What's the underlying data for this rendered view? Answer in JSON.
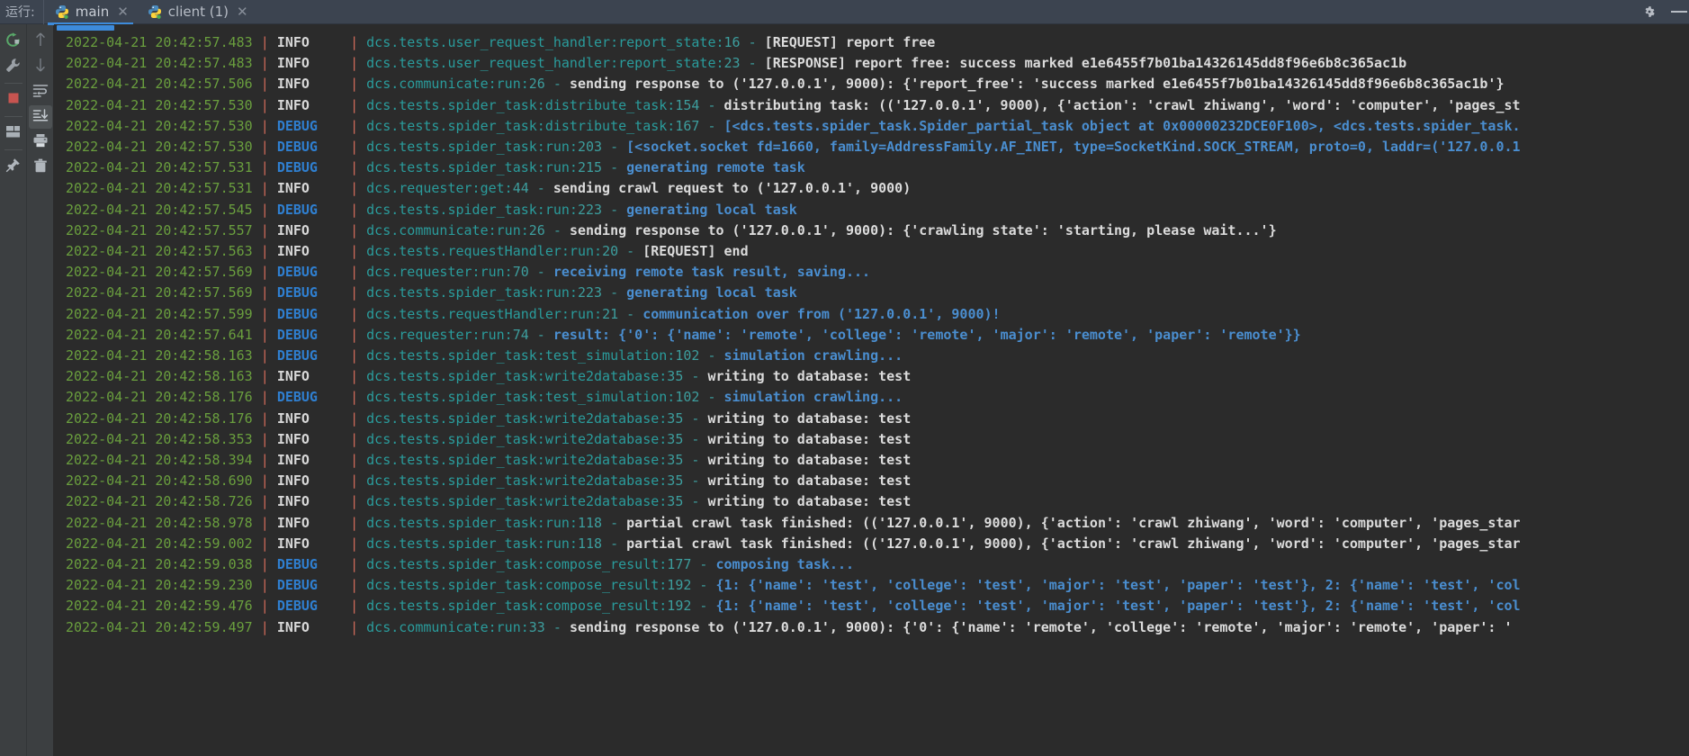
{
  "header": {
    "run_label": "运行:",
    "tabs": [
      {
        "label": "main",
        "close": "✕",
        "active": true,
        "icon": "python-icon"
      },
      {
        "label": "client (1)",
        "close": "✕",
        "active": false,
        "icon": "python-icon"
      }
    ],
    "actions": [
      {
        "name": "settings-gear-icon",
        "label": ""
      },
      {
        "name": "minimize-icon",
        "label": ""
      }
    ]
  },
  "toolbar_left": [
    {
      "name": "rerun-button",
      "icon": "rerun-icon"
    },
    {
      "name": "edit-configuration-button",
      "icon": "wrench-icon"
    },
    {
      "name": "stop-button",
      "icon": "stop-icon"
    },
    {
      "name": "layout-button",
      "icon": "layout-icon"
    },
    {
      "name": "pin-tab-button",
      "icon": "pin-icon"
    }
  ],
  "toolbar_right": [
    {
      "name": "up-the-stack-trace-button",
      "icon": "arrow-up-icon"
    },
    {
      "name": "down-the-stack-trace-button",
      "icon": "arrow-down-icon"
    },
    {
      "name": "soft-wrap-button",
      "icon": "soft-wrap-icon"
    },
    {
      "name": "scroll-to-end-button",
      "icon": "scroll-to-end-icon",
      "selected": true
    },
    {
      "name": "print-button",
      "icon": "print-icon"
    },
    {
      "name": "clear-all-button",
      "icon": "trash-icon"
    }
  ],
  "console": {
    "separator": "|",
    "dash": "-",
    "lines": [
      {
        "ts": "2022-04-21 20:42:57.483",
        "level": "INFO",
        "src": "dcs.tests.user_request_handler:report_state",
        "lno": "16",
        "msg": "[REQUEST] report free"
      },
      {
        "ts": "2022-04-21 20:42:57.483",
        "level": "INFO",
        "src": "dcs.tests.user_request_handler:report_state",
        "lno": "23",
        "msg": "[RESPONSE] report free: success marked e1e6455f7b01ba14326145dd8f96e6b8c365ac1b"
      },
      {
        "ts": "2022-04-21 20:42:57.506",
        "level": "INFO",
        "src": "dcs.communicate:run",
        "lno": "26",
        "msg": "sending response to ('127.0.0.1', 9000): {'report_free': 'success marked e1e6455f7b01ba14326145dd8f96e6b8c365ac1b'}"
      },
      {
        "ts": "2022-04-21 20:42:57.530",
        "level": "INFO",
        "src": "dcs.tests.spider_task:distribute_task",
        "lno": "154",
        "msg": "distributing task: (('127.0.0.1', 9000), {'action': 'crawl zhiwang', 'word': 'computer', 'pages_st"
      },
      {
        "ts": "2022-04-21 20:42:57.530",
        "level": "DEBUG",
        "src": "dcs.tests.spider_task:distribute_task",
        "lno": "167",
        "msg": "[<dcs.tests.spider_task.Spider_partial_task object at 0x00000232DCE0F100>, <dcs.tests.spider_task."
      },
      {
        "ts": "2022-04-21 20:42:57.530",
        "level": "DEBUG",
        "src": "dcs.tests.spider_task:run",
        "lno": "203",
        "msg": "[<socket.socket fd=1660, family=AddressFamily.AF_INET, type=SocketKind.SOCK_STREAM, proto=0, laddr=('127.0.0.1"
      },
      {
        "ts": "2022-04-21 20:42:57.531",
        "level": "DEBUG",
        "src": "dcs.tests.spider_task:run",
        "lno": "215",
        "msg": "generating remote task"
      },
      {
        "ts": "2022-04-21 20:42:57.531",
        "level": "INFO",
        "src": "dcs.requester:get",
        "lno": "44",
        "msg": "sending crawl request to ('127.0.0.1', 9000)"
      },
      {
        "ts": "2022-04-21 20:42:57.545",
        "level": "DEBUG",
        "src": "dcs.tests.spider_task:run",
        "lno": "223",
        "msg": "generating local task"
      },
      {
        "ts": "2022-04-21 20:42:57.557",
        "level": "INFO",
        "src": "dcs.communicate:run",
        "lno": "26",
        "msg": "sending response to ('127.0.0.1', 9000): {'crawling state': 'starting, please wait...'}"
      },
      {
        "ts": "2022-04-21 20:42:57.563",
        "level": "INFO",
        "src": "dcs.tests.requestHandler:run",
        "lno": "20",
        "msg": "[REQUEST] end"
      },
      {
        "ts": "2022-04-21 20:42:57.569",
        "level": "DEBUG",
        "src": "dcs.requester:run",
        "lno": "70",
        "msg": "receiving remote task result, saving..."
      },
      {
        "ts": "2022-04-21 20:42:57.569",
        "level": "DEBUG",
        "src": "dcs.tests.spider_task:run",
        "lno": "223",
        "msg": "generating local task"
      },
      {
        "ts": "2022-04-21 20:42:57.599",
        "level": "DEBUG",
        "src": "dcs.tests.requestHandler:run",
        "lno": "21",
        "msg": "communication over from ('127.0.0.1', 9000)!"
      },
      {
        "ts": "2022-04-21 20:42:57.641",
        "level": "DEBUG",
        "src": "dcs.requester:run",
        "lno": "74",
        "msg": "result: {'0': {'name': 'remote', 'college': 'remote', 'major': 'remote', 'paper': 'remote'}}"
      },
      {
        "ts": "2022-04-21 20:42:58.163",
        "level": "DEBUG",
        "src": "dcs.tests.spider_task:test_simulation",
        "lno": "102",
        "msg": "simulation crawling..."
      },
      {
        "ts": "2022-04-21 20:42:58.163",
        "level": "INFO",
        "src": "dcs.tests.spider_task:write2database",
        "lno": "35",
        "msg": "writing to database: test"
      },
      {
        "ts": "2022-04-21 20:42:58.176",
        "level": "DEBUG",
        "src": "dcs.tests.spider_task:test_simulation",
        "lno": "102",
        "msg": "simulation crawling..."
      },
      {
        "ts": "2022-04-21 20:42:58.176",
        "level": "INFO",
        "src": "dcs.tests.spider_task:write2database",
        "lno": "35",
        "msg": "writing to database: test"
      },
      {
        "ts": "2022-04-21 20:42:58.353",
        "level": "INFO",
        "src": "dcs.tests.spider_task:write2database",
        "lno": "35",
        "msg": "writing to database: test"
      },
      {
        "ts": "2022-04-21 20:42:58.394",
        "level": "INFO",
        "src": "dcs.tests.spider_task:write2database",
        "lno": "35",
        "msg": "writing to database: test"
      },
      {
        "ts": "2022-04-21 20:42:58.690",
        "level": "INFO",
        "src": "dcs.tests.spider_task:write2database",
        "lno": "35",
        "msg": "writing to database: test"
      },
      {
        "ts": "2022-04-21 20:42:58.726",
        "level": "INFO",
        "src": "dcs.tests.spider_task:write2database",
        "lno": "35",
        "msg": "writing to database: test"
      },
      {
        "ts": "2022-04-21 20:42:58.978",
        "level": "INFO",
        "src": "dcs.tests.spider_task:run",
        "lno": "118",
        "msg": "partial crawl task finished: (('127.0.0.1', 9000), {'action': 'crawl zhiwang', 'word': 'computer', 'pages_star"
      },
      {
        "ts": "2022-04-21 20:42:59.002",
        "level": "INFO",
        "src": "dcs.tests.spider_task:run",
        "lno": "118",
        "msg": "partial crawl task finished: (('127.0.0.1', 9000), {'action': 'crawl zhiwang', 'word': 'computer', 'pages_star"
      },
      {
        "ts": "2022-04-21 20:42:59.038",
        "level": "DEBUG",
        "src": "dcs.tests.spider_task:compose_result",
        "lno": "177",
        "msg": "composing task..."
      },
      {
        "ts": "2022-04-21 20:42:59.230",
        "level": "DEBUG",
        "src": "dcs.tests.spider_task:compose_result",
        "lno": "192",
        "msg": "{1: {'name': 'test', 'college': 'test', 'major': 'test', 'paper': 'test'}, 2: {'name': 'test', 'col"
      },
      {
        "ts": "2022-04-21 20:42:59.476",
        "level": "DEBUG",
        "src": "dcs.tests.spider_task:compose_result",
        "lno": "192",
        "msg": "{1: {'name': 'test', 'college': 'test', 'major': 'test', 'paper': 'test'}, 2: {'name': 'test', 'col"
      },
      {
        "ts": "2022-04-21 20:42:59.497",
        "level": "INFO",
        "src": "dcs.communicate:run",
        "lno": "33",
        "msg": "sending response to ('127.0.0.1', 9000): {'0': {'name': 'remote', 'college': 'remote', 'major': 'remote', 'paper': '"
      }
    ]
  },
  "colors": {
    "background": "#2b2b2b",
    "header_bg": "#3c4450",
    "toolbar_bg": "#3c3f41",
    "accent_blue": "#3d8bdb",
    "timestamp_green": "#6a9f3e",
    "separator_red": "#cf6a5a",
    "logger_cyan": "#2a9c9c",
    "debug_blue": "#2f7fd0",
    "info_white": "#dcdcdc",
    "stop_red": "#c75450",
    "rerun_green": "#59a869"
  }
}
